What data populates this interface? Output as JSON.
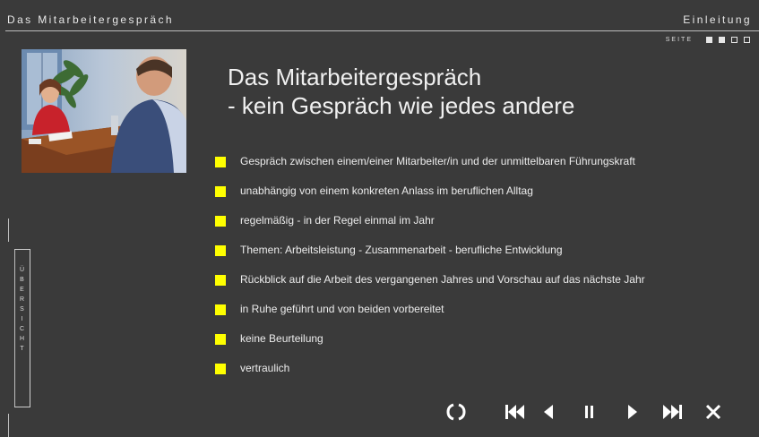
{
  "header": {
    "left_title": "Das Mitarbeitergespräch",
    "right_title": "Einleitung"
  },
  "page_indicator": {
    "label": "SEITE",
    "pages": [
      {
        "state": "filled"
      },
      {
        "state": "filled"
      },
      {
        "state": "empty"
      },
      {
        "state": "empty"
      }
    ]
  },
  "photo": {
    "description_icon": "meeting-photo"
  },
  "main": {
    "title_line1": "Das Mitarbeitergespräch",
    "title_line2": "- kein Gespräch wie jedes andere",
    "bullets": [
      "Gespräch zwischen einem/einer Mitarbeiter/in und der unmittelbaren Führungskraft",
      "unabhängig von einem konkreten Anlass im beruflichen Alltag",
      "regelmäßig - in der Regel einmal im Jahr",
      "Themen: Arbeitsleistung - Zusammenarbeit - berufliche Entwicklung",
      "Rückblick auf die Arbeit des vergangenen Jahres und Vorschau auf das nächste Jahr",
      "in Ruhe geführt und von beiden vorbereitet",
      "keine Beurteilung",
      "vertraulich"
    ]
  },
  "sidebar": {
    "tab_letters": [
      "Ü",
      "B",
      "E",
      "R",
      "S",
      "I",
      "C",
      "H",
      "T"
    ]
  },
  "controls": [
    {
      "name": "replay-icon"
    },
    {
      "name": "first-page-icon"
    },
    {
      "name": "previous-icon"
    },
    {
      "name": "pause-icon"
    },
    {
      "name": "next-icon"
    },
    {
      "name": "last-page-icon"
    },
    {
      "name": "close-icon"
    }
  ],
  "colors": {
    "background": "#3a3a3a",
    "bullet": "#ffff00",
    "text": "#ececec"
  }
}
